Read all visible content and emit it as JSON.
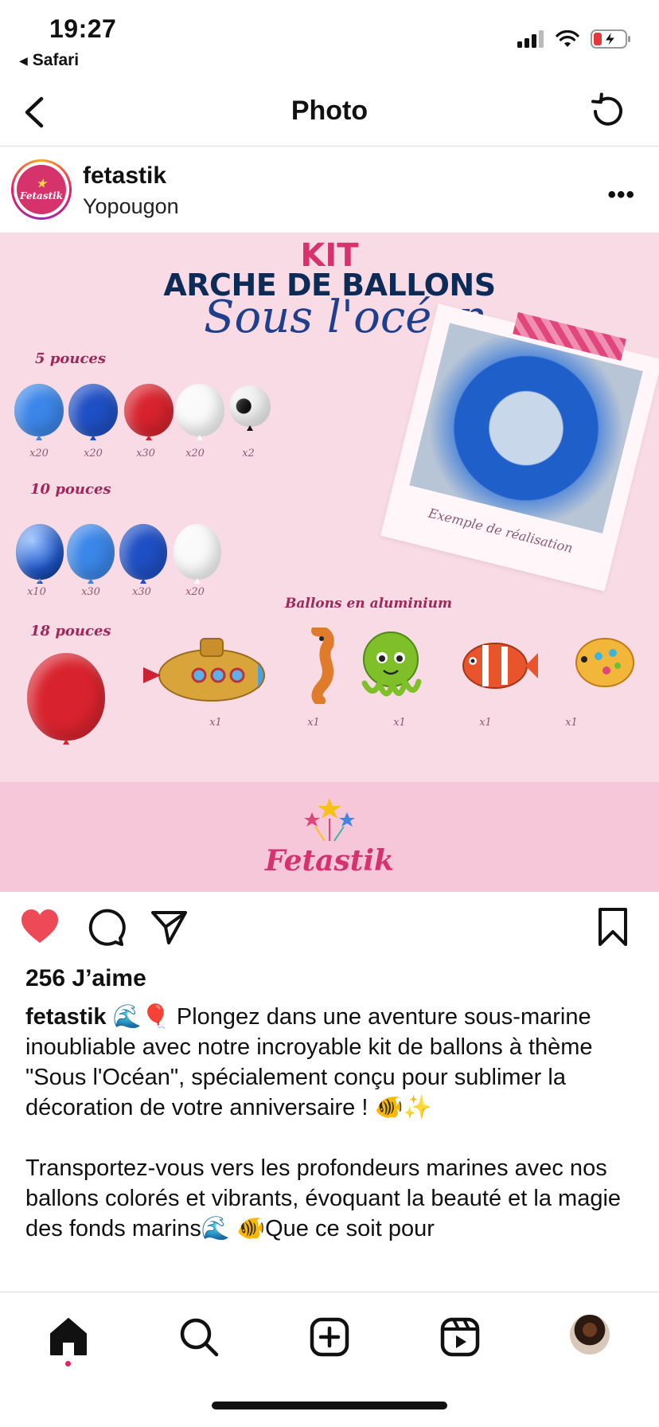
{
  "status_bar": {
    "time": "19:27",
    "back_app": "Safari",
    "icons": [
      "signal-icon",
      "wifi-icon",
      "battery-charging-icon"
    ]
  },
  "navbar": {
    "title": "Photo",
    "back_icon": "chevron-left-icon",
    "refresh_icon": "refresh-icon"
  },
  "post": {
    "username": "fetastik",
    "location": "Yopougon",
    "avatar_text": "Fetastik",
    "more_label": "•••"
  },
  "image": {
    "kit": "KIT",
    "title": "ARCHE DE BALLONS",
    "subtitle": "Sous l'océan",
    "sections": [
      {
        "label": "5 pouces",
        "quantities": [
          "x20",
          "x20",
          "x30",
          "x20",
          "x2"
        ]
      },
      {
        "label": "10 pouces",
        "quantities": [
          "x10",
          "x30",
          "x30",
          "x20"
        ]
      },
      {
        "label": "18 pouces",
        "quantities": []
      }
    ],
    "aluminium_title": "Ballons en aluminium",
    "aluminium_quantities": [
      "x1",
      "x1",
      "x1",
      "x1",
      "x1"
    ],
    "example_caption": "Exemple de réalisation",
    "brand": "Fetastik"
  },
  "actions": {
    "like_icon": "heart-filled-icon",
    "comment_icon": "comment-icon",
    "share_icon": "send-icon",
    "save_icon": "bookmark-icon",
    "like_color": "#ed4956"
  },
  "likes": "256 J’aime",
  "caption": {
    "username": "fetastik",
    "paragraph1": " 🌊🎈 Plongez dans une aventure sous-marine inoubliable avec notre incroyable kit de ballons à thème \"Sous l'Océan\", spécialement conçu pour sublimer la décoration de votre anniversaire ! 🐠✨",
    "paragraph2": "Transportez-vous vers les profondeurs marines avec nos ballons colorés et vibrants, évoquant la beauté et la magie des fonds marins🌊 🐠Que ce soit pour"
  },
  "tabbar": {
    "tabs": [
      "home-icon",
      "search-icon",
      "create-icon",
      "reels-icon",
      "profile-avatar"
    ]
  }
}
